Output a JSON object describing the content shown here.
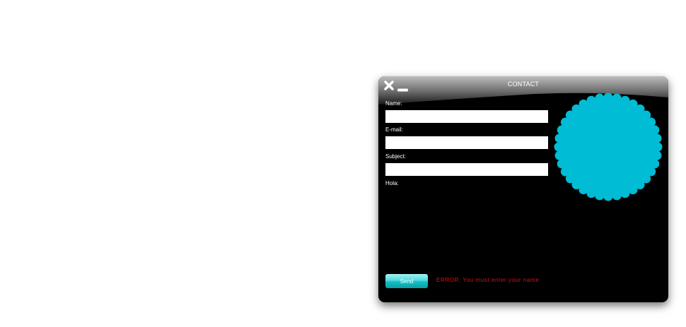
{
  "window": {
    "title": "CONTACT",
    "colors": {
      "background": "#000000",
      "accent": "#00bcd4",
      "error": "#e01010"
    }
  },
  "titlebar": {
    "close_icon": "close-icon",
    "minimize_icon": "minimize-icon"
  },
  "form": {
    "name_label": "Name:",
    "name_value": "",
    "email_label": "E-mail:",
    "email_value": "",
    "subject_label": "Subject:",
    "subject_value": "",
    "message_label": "Hola:",
    "message_value": "",
    "send_label": "Send"
  },
  "status": {
    "error_text": "ERROR: You must enter your name"
  },
  "decoration": {
    "badge_icon": "scalloped-badge-icon"
  }
}
